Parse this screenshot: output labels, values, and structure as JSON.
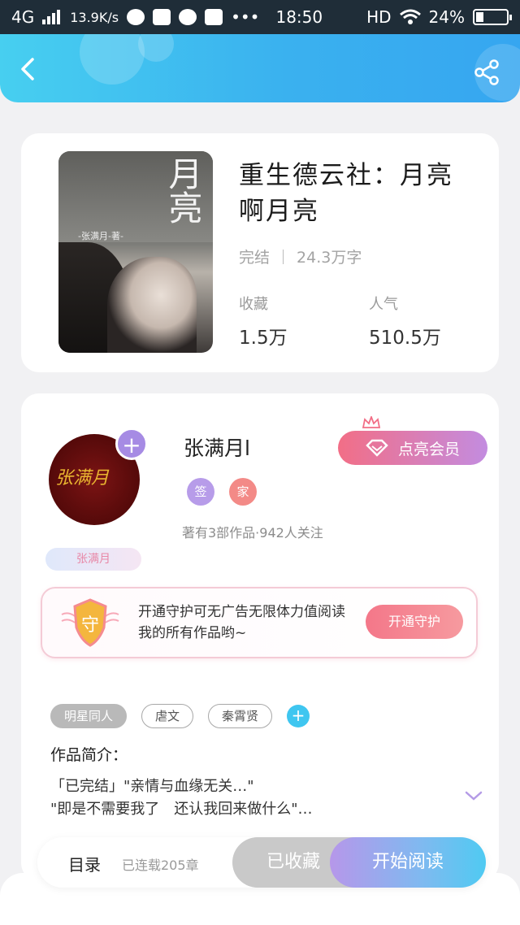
{
  "status_bar": {
    "network": "4G",
    "speed": "13.9K/s",
    "time": "18:50",
    "hd": "HD",
    "battery": "24%"
  },
  "header": {
    "back_icon": "back-arrow-icon",
    "share_icon": "share-icon",
    "gradient": [
      "#47cff0",
      "#36a6f0"
    ]
  },
  "book": {
    "title": "重生德云社：月亮啊月亮",
    "cover_big_text": "月亮",
    "cover_author": "-张满月-著-",
    "status": "完结",
    "word_count": "24.3万字",
    "favorites_label": "收藏",
    "favorites_value": "1.5万",
    "popularity_label": "人气",
    "popularity_value": "510.5万"
  },
  "author": {
    "avatar_signature": "张满月",
    "name": "张满月l",
    "vip_button": "点亮会员",
    "badge_sign": "签",
    "badge_family": "家",
    "info": "著有3部作品·942人关注",
    "ribbon": "张满月"
  },
  "guard": {
    "icon_text": "守",
    "text": "开通守护可无广告无限体力值阅读我的所有作品哟~",
    "button": "开通守护"
  },
  "tags": {
    "items": [
      "明星同人",
      "虐文",
      "秦霄贤"
    ]
  },
  "intro": {
    "title": "作品简介：",
    "text": "「已完结」\"亲情与血缘无关…\"\n\"即是不需要我了　还认我回来做什么\"…"
  },
  "bottom_bar": {
    "toc": "目录",
    "chapters": "已连载205章",
    "collected": "已收藏",
    "start_reading": "开始阅读"
  },
  "colors": {
    "accent_blue": "#3ab1ef",
    "vip_pink": "#f26e86",
    "purple": "#a68be4"
  }
}
